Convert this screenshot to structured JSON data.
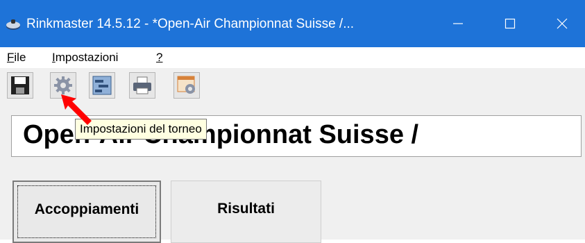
{
  "window": {
    "title": "Rinkmaster 14.5.12 - *Open-Air Championnat Suisse /...",
    "controls": [
      "minimize-icon",
      "maximize-icon",
      "close-icon"
    ]
  },
  "menu": {
    "file": {
      "accel": "F",
      "rest": "ile"
    },
    "settings": {
      "accel": "I",
      "rest": "mpostazioni"
    },
    "help": {
      "accel": "?",
      "rest": ""
    }
  },
  "toolbar": {
    "buttons": [
      "save-icon",
      "gear-icon",
      "structure-icon",
      "printer-icon",
      "settings-window-icon"
    ]
  },
  "event": {
    "title": "Open-Air Championnat Suisse /"
  },
  "tooltip": {
    "text": "Impostazioni del torneo"
  },
  "tabs": {
    "pairings": "Accoppiamenti",
    "results": "Risultati"
  },
  "colors": {
    "titlebar": "#1e73d8",
    "tooltip_bg": "#ffffe1",
    "arrow": "#ff0000"
  }
}
